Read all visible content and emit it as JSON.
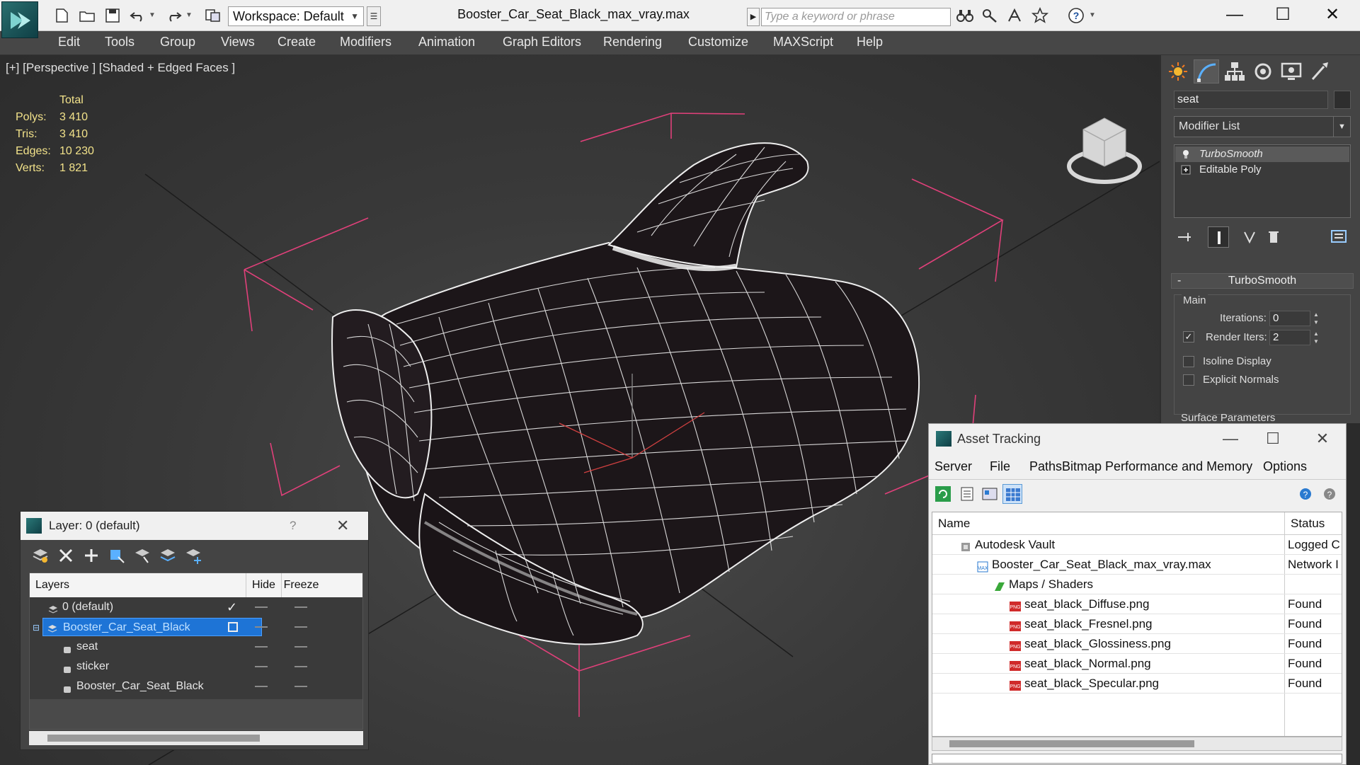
{
  "titlebar": {
    "workspace": "Workspace: Default",
    "document_title": "Booster_Car_Seat_Black_max_vray.max",
    "search_placeholder": "Type a keyword or phrase"
  },
  "menu": [
    "Edit",
    "Tools",
    "Group",
    "Views",
    "Create",
    "Modifiers",
    "Animation",
    "Graph Editors",
    "Rendering",
    "Customize",
    "MAXScript",
    "Help"
  ],
  "viewport": {
    "label": "[+] [Perspective ] [Shaded + Edged Faces ]",
    "stats": {
      "header": "Total",
      "rows": [
        {
          "label": "Polys:",
          "value": "3 410"
        },
        {
          "label": "Tris:",
          "value": "3 410"
        },
        {
          "label": "Edges:",
          "value": "10 230"
        },
        {
          "label": "Verts:",
          "value": "1 821"
        }
      ]
    }
  },
  "command_panel": {
    "object_name": "seat",
    "modifier_list": "Modifier List",
    "stack": [
      {
        "label": "TurboSmooth",
        "selected": true
      },
      {
        "label": "Editable Poly",
        "selected": false
      }
    ],
    "rollout_title": "TurboSmooth",
    "group_main": "Main",
    "iterations_label": "Iterations:",
    "iterations_value": "0",
    "render_iters_label": "Render Iters:",
    "render_iters_value": "2",
    "isoline_label": "Isoline Display",
    "explicit_label": "Explicit Normals",
    "surface_label": "Surface Parameters"
  },
  "layer_window": {
    "title": "Layer: 0 (default)",
    "help": "?",
    "col_layers": "Layers",
    "col_hide": "Hide",
    "col_freeze": "Freeze",
    "rows": [
      {
        "name": "0 (default)"
      },
      {
        "name": "Booster_Car_Seat_Black"
      },
      {
        "name": "seat"
      },
      {
        "name": "sticker"
      },
      {
        "name": "Booster_Car_Seat_Black"
      }
    ]
  },
  "asset_window": {
    "title": "Asset Tracking",
    "menu": [
      "Server",
      "File",
      "Paths",
      "Bitmap Performance and Memory",
      "Options"
    ],
    "col_name": "Name",
    "col_status": "Status",
    "rows": [
      {
        "name": "Autodesk Vault",
        "status": "Logged C"
      },
      {
        "name": "Booster_Car_Seat_Black_max_vray.max",
        "status": "Network I"
      },
      {
        "name": "Maps / Shaders",
        "status": ""
      },
      {
        "name": "seat_black_Diffuse.png",
        "status": "Found"
      },
      {
        "name": "seat_black_Fresnel.png",
        "status": "Found"
      },
      {
        "name": "seat_black_Glossiness.png",
        "status": "Found"
      },
      {
        "name": "seat_black_Normal.png",
        "status": "Found"
      },
      {
        "name": "seat_black_Specular.png",
        "status": "Found"
      }
    ]
  },
  "icons": [
    "app-logo-icon",
    "new-file-icon",
    "open-folder-icon",
    "save-icon",
    "undo-icon",
    "redo-icon",
    "project-icon",
    "binoculars-icon",
    "key-icon",
    "star-icon",
    "help-icon",
    "sun-icon",
    "curve-icon",
    "hierarchy-icon",
    "motion-icon",
    "display-icon",
    "utilities-icon",
    "png-file-icon",
    "vault-icon",
    "max-file-icon",
    "maps-folder-icon"
  ],
  "colors": {
    "accent_selection": "#1e74d6",
    "stats_text": "#f2e28a",
    "bounding_box": "#e0407a"
  }
}
